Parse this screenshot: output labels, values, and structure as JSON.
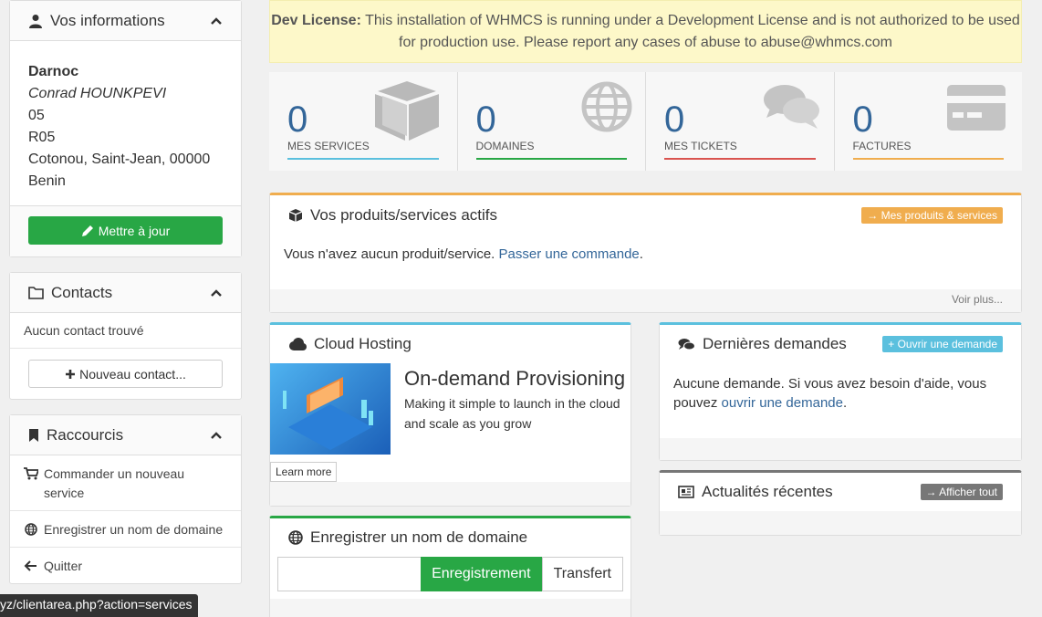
{
  "sidebar": {
    "info": {
      "title": "Vos informations",
      "company": "Darnoc",
      "contact_name": "Conrad HOUNKPEVI",
      "line1": "05",
      "line2": "R05",
      "city_line": "Cotonou, Saint-Jean, 00000",
      "country": "Benin",
      "update_label": "Mettre à jour"
    },
    "contacts": {
      "title": "Contacts",
      "empty": "Aucun contact trouvé",
      "new_label": "Nouveau contact..."
    },
    "shortcuts": {
      "title": "Raccourcis",
      "items": [
        {
          "label": "Commander un nouveau service",
          "icon": "cart-icon"
        },
        {
          "label": "Enregistrer un nom de domaine",
          "icon": "globe-icon"
        },
        {
          "label": "Quitter",
          "icon": "arrow-left-icon"
        }
      ]
    }
  },
  "license": {
    "bold": "Dev License:",
    "text": "This installation of WHMCS is running under a Development License and is not authorized to be used for production use. Please report any cases of abuse to abuse@whmcs.com"
  },
  "stats": [
    {
      "value": "0",
      "label": "MES SERVICES",
      "color": "#5bc0de",
      "icon": "cube-icon"
    },
    {
      "value": "0",
      "label": "DOMAINES",
      "color": "#28a745",
      "icon": "globe-icon"
    },
    {
      "value": "0",
      "label": "MES TICKETS",
      "color": "#d9534f",
      "icon": "comments-icon"
    },
    {
      "value": "0",
      "label": "FACTURES",
      "color": "#f0ad4e",
      "icon": "credit-card-icon"
    }
  ],
  "products": {
    "title": "Vos produits/services actifs",
    "tag": "Mes produits & services",
    "text": "Vous n'avez aucun produit/service.",
    "link": "Passer une commande",
    "more": "Voir plus..."
  },
  "cloud": {
    "title": "Cloud Hosting",
    "heading": "On-demand Provisioning",
    "desc": "Making it simple to launch in the cloud and scale as you grow",
    "learn": "Learn more"
  },
  "domain": {
    "title": "Enregistrer un nom de domaine",
    "register": "Enregistrement",
    "transfer": "Transfert"
  },
  "tickets": {
    "title": "Dernières demandes",
    "tag": "Ouvrir une demande",
    "text": "Aucune demande. Si vous avez besoin d'aide, vous pouvez",
    "link": "ouvrir une demande"
  },
  "news": {
    "title": "Actualités récentes",
    "tag": "Afficher tout"
  },
  "status_bar": "yz/clientarea.php?action=services"
}
